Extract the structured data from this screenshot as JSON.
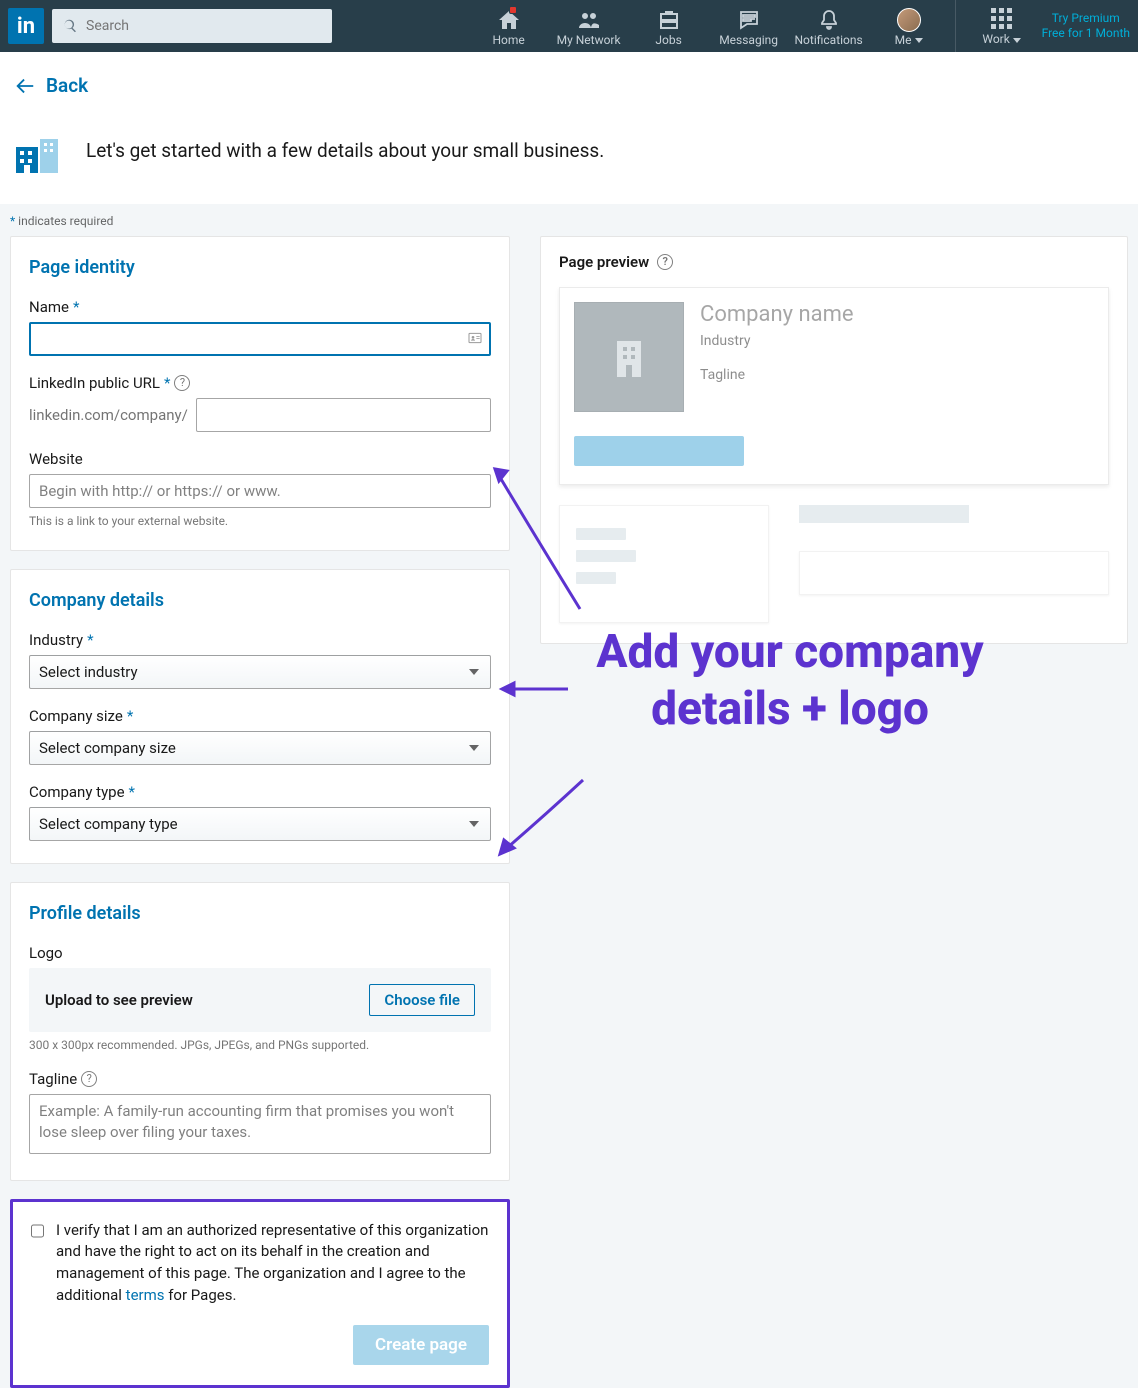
{
  "nav": {
    "search_placeholder": "Search",
    "home": "Home",
    "network": "My Network",
    "jobs": "Jobs",
    "messaging": "Messaging",
    "notifications": "Notifications",
    "me": "Me",
    "work": "Work",
    "premium_l1": "Try Premium",
    "premium_l2": "Free for 1 Month"
  },
  "back": "Back",
  "intro": "Let's get started with a few details about your small business.",
  "required_note": "indicates required",
  "section1": {
    "title": "Page identity",
    "name_label": "Name",
    "url_label": "LinkedIn public URL",
    "url_prefix": "linkedin.com/company/",
    "website_label": "Website",
    "website_placeholder": "Begin with http:// or https:// or www.",
    "website_hint": "This is a link to your external website."
  },
  "section2": {
    "title": "Company details",
    "industry_label": "Industry",
    "industry_selected": "Select industry",
    "size_label": "Company size",
    "size_selected": "Select company size",
    "type_label": "Company type",
    "type_selected": "Select company type"
  },
  "section3": {
    "title": "Profile details",
    "logo_label": "Logo",
    "upload_text": "Upload to see preview",
    "choose_file": "Choose file",
    "logo_hint": "300 x 300px recommended. JPGs, JPEGs, and PNGs supported.",
    "tagline_label": "Tagline",
    "tagline_placeholder": "Example: A family-run accounting firm that promises you won't lose sleep over filing your taxes."
  },
  "verify": {
    "text_1": "I verify that I am an authorized representative of this organization and have the right to act on its behalf in the creation and management of this page. The organization and I agree to the additional ",
    "terms": "terms",
    "text_2": " for Pages.",
    "button": "Create page"
  },
  "preview": {
    "title": "Page preview",
    "company_name": "Company name",
    "industry": "Industry",
    "tagline": "Tagline"
  },
  "annotation": "Add your company details + logo"
}
